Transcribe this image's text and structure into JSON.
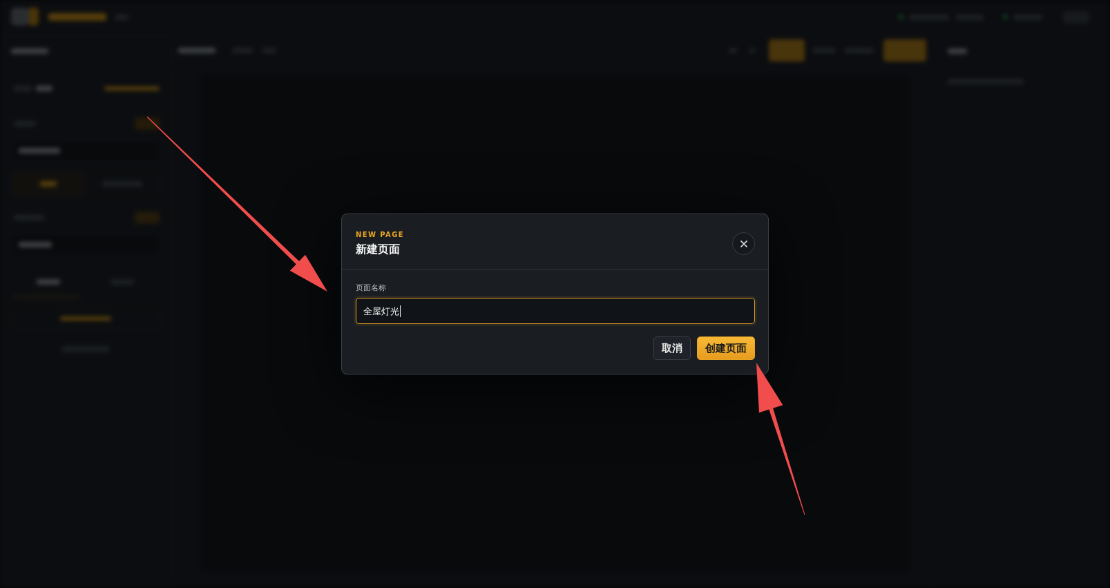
{
  "backdrop": {
    "blurred": true
  },
  "dialog": {
    "eyebrow": "NEW PAGE",
    "title": "新建页面",
    "field": {
      "label": "页面名称",
      "value": "全屋灯光",
      "focused": true
    },
    "buttons": [
      {
        "label": "取消",
        "kind": "secondary"
      },
      {
        "label": "创建页面",
        "kind": "primary"
      }
    ]
  },
  "annotations": [
    {
      "kind": "arrow"
    },
    {
      "kind": "arrow"
    }
  ]
}
